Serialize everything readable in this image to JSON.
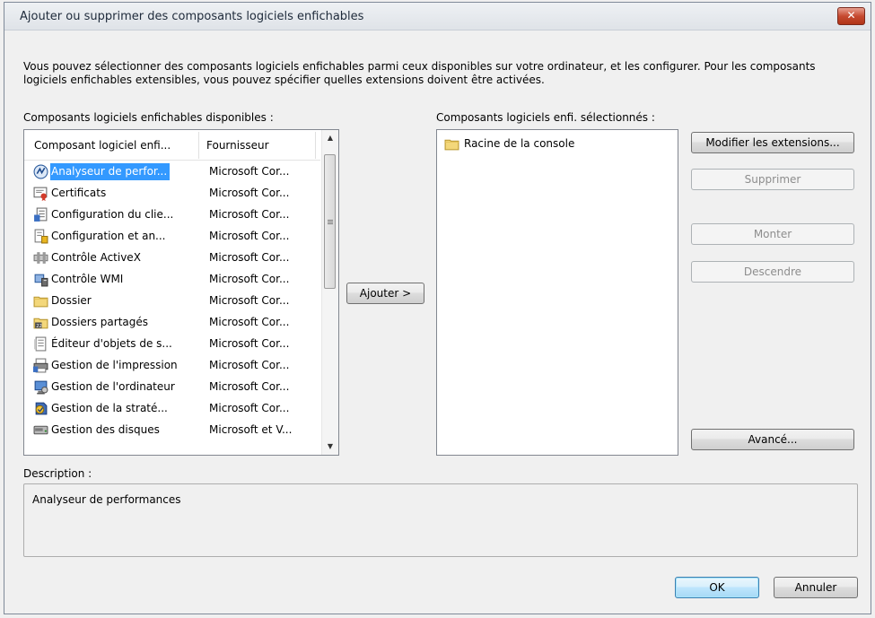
{
  "window": {
    "title": "Ajouter ou supprimer des composants logiciels enfichables",
    "close_glyph": "✕"
  },
  "intro_text": "Vous pouvez sélectionner des composants logiciels enfichables parmi ceux disponibles sur votre ordinateur, et les configurer. Pour les composants logiciels enfichables extensibles, vous pouvez spécifier quelles extensions doivent être activées.",
  "available": {
    "label": "Composants logiciels enfichables disponibles :",
    "columns": [
      "Composant logiciel enfi...",
      "Fournisseur"
    ],
    "items": [
      {
        "name": "Analyseur de perfor...",
        "provider": "Microsoft Cor...",
        "icon": "performance-monitor-icon",
        "selected": true
      },
      {
        "name": "Certificats",
        "provider": "Microsoft Cor...",
        "icon": "certificates-icon"
      },
      {
        "name": "Configuration du clie...",
        "provider": "Microsoft Cor...",
        "icon": "client-config-icon"
      },
      {
        "name": "Configuration et an...",
        "provider": "Microsoft Cor...",
        "icon": "security-config-icon"
      },
      {
        "name": "Contrôle ActiveX",
        "provider": "Microsoft Cor...",
        "icon": "activex-icon"
      },
      {
        "name": "Contrôle WMI",
        "provider": "Microsoft Cor...",
        "icon": "wmi-icon"
      },
      {
        "name": "Dossier",
        "provider": "Microsoft Cor...",
        "icon": "folder-icon"
      },
      {
        "name": "Dossiers partagés",
        "provider": "Microsoft Cor...",
        "icon": "shared-folders-icon"
      },
      {
        "name": "Éditeur d'objets de s...",
        "provider": "Microsoft Cor...",
        "icon": "policy-editor-icon"
      },
      {
        "name": "Gestion de l'impression",
        "provider": "Microsoft Cor...",
        "icon": "printer-icon"
      },
      {
        "name": "Gestion de l'ordinateur",
        "provider": "Microsoft Cor...",
        "icon": "computer-management-icon"
      },
      {
        "name": "Gestion de la straté...",
        "provider": "Microsoft Cor...",
        "icon": "policy-management-icon"
      },
      {
        "name": "Gestion des disques",
        "provider": "Microsoft et V...",
        "icon": "disk-icon"
      }
    ]
  },
  "add_button": "Ajouter >",
  "selected": {
    "label": "Composants logiciels enfi. sélectionnés :",
    "items": [
      {
        "name": "Racine de la console",
        "icon": "folder-icon"
      }
    ]
  },
  "side_buttons": {
    "edit_extensions": "Modifier les extensions...",
    "remove": "Supprimer",
    "move_up": "Monter",
    "move_down": "Descendre",
    "advanced": "Avancé..."
  },
  "description": {
    "label": "Description :",
    "text": "Analyseur de performances"
  },
  "footer": {
    "ok": "OK",
    "cancel": "Annuler"
  },
  "colors": {
    "selection": "#3399ff",
    "default_button_border": "#3c7fb1",
    "close_button": "#c64a30"
  }
}
